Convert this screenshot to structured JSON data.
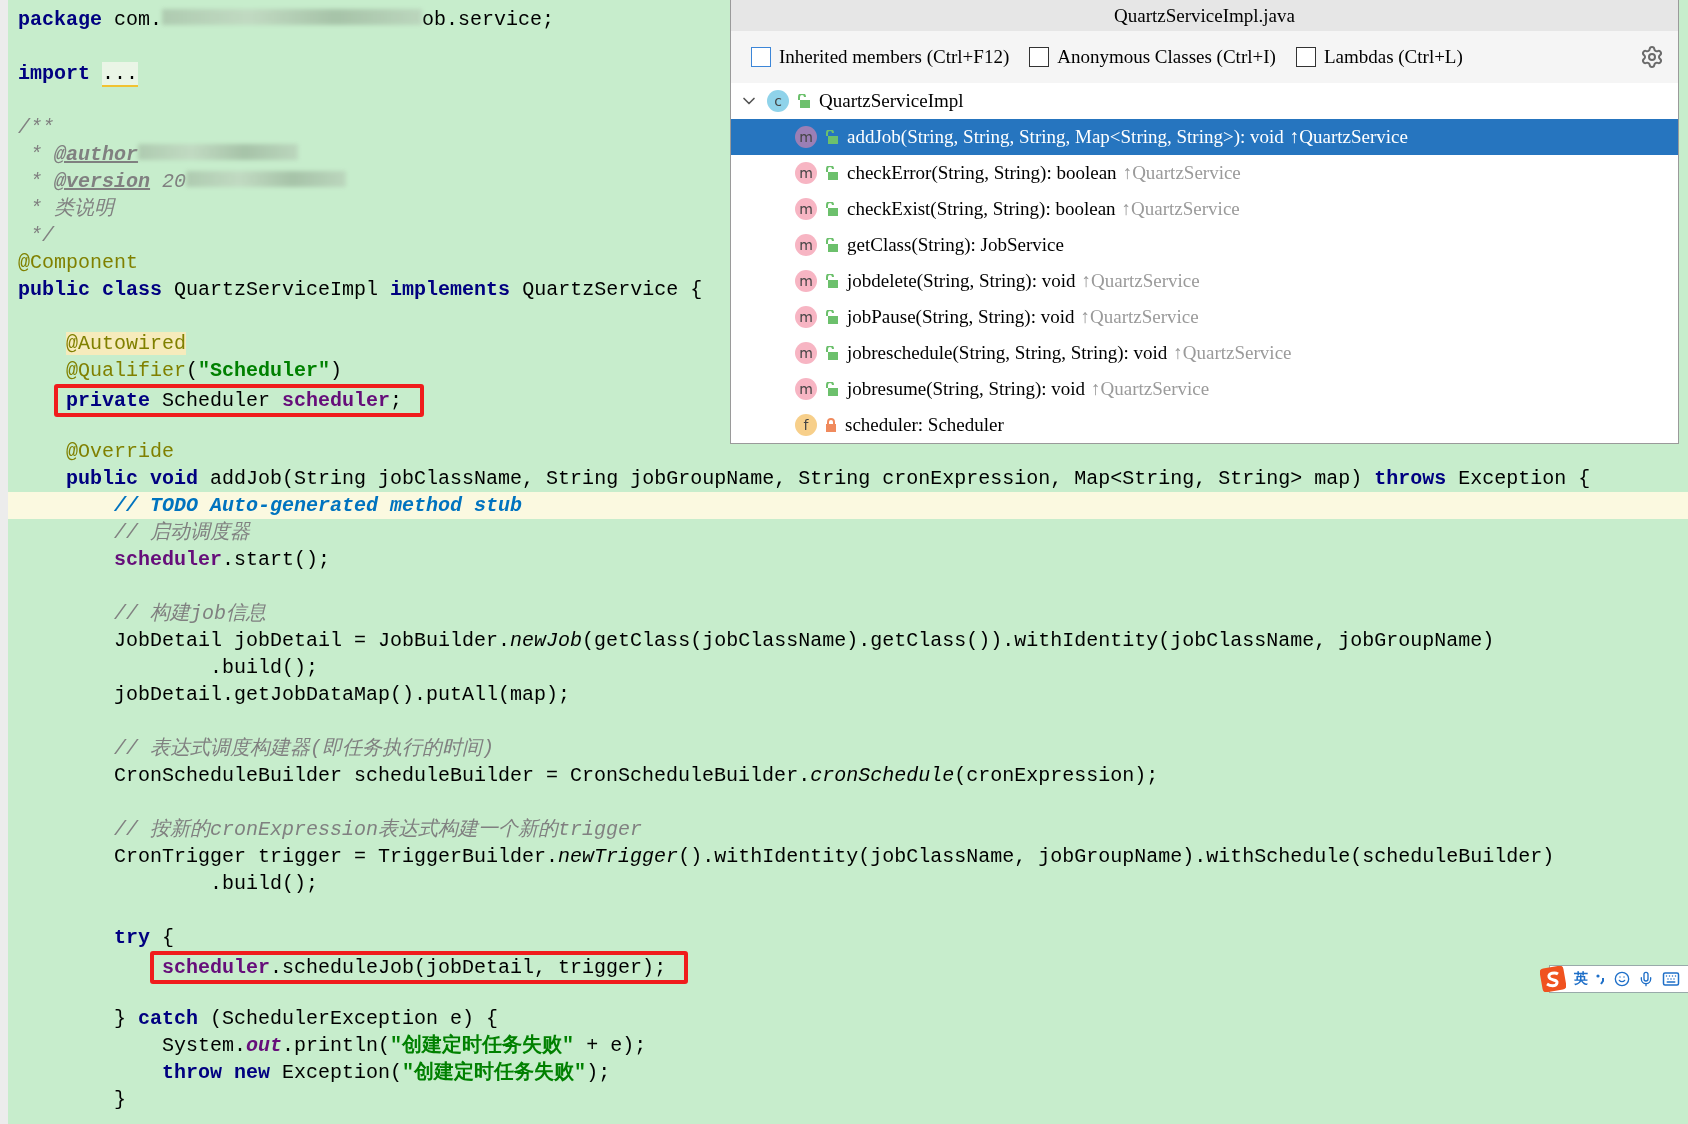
{
  "editor": {
    "lines": [
      {
        "kind": "code",
        "tokens": [
          {
            "kind": "kw",
            "t": "package"
          },
          {
            "kind": "plain",
            "t": " com."
          },
          {
            "kind": "redacted"
          },
          {
            "kind": "plain",
            "t": "ob.service;"
          }
        ]
      },
      {
        "kind": "blank"
      },
      {
        "kind": "code",
        "tokens": [
          {
            "kind": "kw",
            "t": "import "
          },
          {
            "kind": "folded",
            "t": "..."
          }
        ]
      },
      {
        "kind": "blank"
      },
      {
        "kind": "code",
        "tokens": [
          {
            "kind": "cmt",
            "t": "/**"
          }
        ]
      },
      {
        "kind": "code",
        "tokens": [
          {
            "kind": "cmt",
            "t": " * "
          },
          {
            "kind": "doctag",
            "t": "@author"
          },
          {
            "kind": "redacted"
          }
        ]
      },
      {
        "kind": "code",
        "tokens": [
          {
            "kind": "cmt",
            "t": " * "
          },
          {
            "kind": "doctag",
            "t": "@version"
          },
          {
            "kind": "cmt",
            "t": " 20"
          },
          {
            "kind": "redacted"
          }
        ]
      },
      {
        "kind": "code",
        "tokens": [
          {
            "kind": "cmt",
            "t": " * 类说明"
          }
        ]
      },
      {
        "kind": "code",
        "tokens": [
          {
            "kind": "cmt",
            "t": " */"
          }
        ]
      },
      {
        "kind": "code",
        "tokens": [
          {
            "kind": "ann",
            "t": "@Component"
          }
        ]
      },
      {
        "kind": "code",
        "tokens": [
          {
            "kind": "kw",
            "t": "public class"
          },
          {
            "kind": "plain",
            "t": " QuartzServiceImpl "
          },
          {
            "kind": "kw",
            "t": "implements"
          },
          {
            "kind": "plain",
            "t": " QuartzService {"
          }
        ]
      },
      {
        "kind": "blank"
      },
      {
        "kind": "code",
        "tokens": [
          {
            "kind": "annhl",
            "t": "    @Autowired"
          }
        ]
      },
      {
        "kind": "code",
        "tokens": [
          {
            "kind": "ann",
            "t": "    @Qualifier"
          },
          {
            "kind": "plain",
            "t": "("
          },
          {
            "kind": "str",
            "t": "\"Scheduler\""
          },
          {
            "kind": "plain",
            "t": ")"
          }
        ]
      },
      {
        "kind": "code",
        "boxed": true,
        "tokens": [
          {
            "kind": "kw",
            "t": "    private"
          },
          {
            "kind": "plain",
            "t": " Scheduler "
          },
          {
            "kind": "field",
            "t": "scheduler"
          },
          {
            "kind": "plain",
            "t": ";"
          }
        ]
      },
      {
        "kind": "blank"
      },
      {
        "kind": "code",
        "tokens": [
          {
            "kind": "ann",
            "t": "    @Override"
          }
        ]
      },
      {
        "kind": "code",
        "tokens": [
          {
            "kind": "kw",
            "t": "    public void"
          },
          {
            "kind": "plain",
            "t": " addJob(String jobClassName, String jobGroupName, String cronExpression, Map<String, String> map) "
          },
          {
            "kind": "kw",
            "t": "throws"
          },
          {
            "kind": "plain",
            "t": " Exception {"
          }
        ]
      },
      {
        "kind": "code",
        "current": true,
        "tokens": [
          {
            "kind": "todo",
            "t": "        // TODO Auto-generated method stub"
          }
        ]
      },
      {
        "kind": "code",
        "tokens": [
          {
            "kind": "cmt",
            "t": "        // 启动调度器"
          }
        ]
      },
      {
        "kind": "code",
        "tokens": [
          {
            "kind": "field",
            "t": "        scheduler"
          },
          {
            "kind": "plain",
            "t": ".start();"
          }
        ]
      },
      {
        "kind": "blank"
      },
      {
        "kind": "code",
        "tokens": [
          {
            "kind": "cmt",
            "t": "        // 构建job信息"
          }
        ]
      },
      {
        "kind": "code",
        "tokens": [
          {
            "kind": "plain",
            "t": "        JobDetail jobDetail = JobBuilder."
          },
          {
            "kind": "italic",
            "t": "newJob"
          },
          {
            "kind": "plain",
            "t": "(getClass(jobClassName).getClass()).withIdentity(jobClassName, jobGroupName)"
          }
        ]
      },
      {
        "kind": "code",
        "tokens": [
          {
            "kind": "plain",
            "t": "                .build();"
          }
        ]
      },
      {
        "kind": "code",
        "tokens": [
          {
            "kind": "plain",
            "t": "        jobDetail.getJobDataMap().putAll(map);"
          }
        ]
      },
      {
        "kind": "blank"
      },
      {
        "kind": "code",
        "tokens": [
          {
            "kind": "cmt",
            "t": "        // 表达式调度构建器(即任务执行的时间)"
          }
        ]
      },
      {
        "kind": "code",
        "tokens": [
          {
            "kind": "plain",
            "t": "        CronScheduleBuilder scheduleBuilder = CronScheduleBuilder."
          },
          {
            "kind": "italic",
            "t": "cronSchedule"
          },
          {
            "kind": "plain",
            "t": "(cronExpression);"
          }
        ]
      },
      {
        "kind": "blank"
      },
      {
        "kind": "code",
        "tokens": [
          {
            "kind": "cmt",
            "t": "        // 按新的cronExpression表达式构建一个新的trigger"
          }
        ]
      },
      {
        "kind": "code",
        "tokens": [
          {
            "kind": "plain",
            "t": "        CronTrigger trigger = TriggerBuilder."
          },
          {
            "kind": "italic",
            "t": "newTrigger"
          },
          {
            "kind": "plain",
            "t": "().withIdentity(jobClassName, jobGroupName).withSchedule(scheduleBuilder)"
          }
        ]
      },
      {
        "kind": "code",
        "tokens": [
          {
            "kind": "plain",
            "t": "                .build();"
          }
        ]
      },
      {
        "kind": "blank"
      },
      {
        "kind": "code",
        "tokens": [
          {
            "kind": "kw",
            "t": "        try"
          },
          {
            "kind": "plain",
            "t": " {"
          }
        ]
      },
      {
        "kind": "code",
        "boxed": true,
        "tokens": [
          {
            "kind": "field",
            "t": "            scheduler"
          },
          {
            "kind": "plain",
            "t": ".scheduleJob(jobDetail, trigger);"
          }
        ]
      },
      {
        "kind": "blank"
      },
      {
        "kind": "code",
        "tokens": [
          {
            "kind": "plain",
            "t": "        } "
          },
          {
            "kind": "kw",
            "t": "catch"
          },
          {
            "kind": "plain",
            "t": " (SchedulerException e) {"
          }
        ]
      },
      {
        "kind": "code",
        "tokens": [
          {
            "kind": "plain",
            "t": "            System."
          },
          {
            "kind": "static",
            "t": "out"
          },
          {
            "kind": "plain",
            "t": ".println("
          },
          {
            "kind": "str",
            "t": "\"创建定时任务失败\""
          },
          {
            "kind": "plain",
            "t": " + e);"
          }
        ]
      },
      {
        "kind": "code",
        "tokens": [
          {
            "kind": "kw",
            "t": "            throw new"
          },
          {
            "kind": "plain",
            "t": " Exception("
          },
          {
            "kind": "str",
            "t": "\"创建定时任务失败\""
          },
          {
            "kind": "plain",
            "t": ");"
          }
        ]
      },
      {
        "kind": "code",
        "tokens": [
          {
            "kind": "plain",
            "t": "        }"
          }
        ]
      }
    ]
  },
  "structure_popup": {
    "title": "QuartzServiceImpl.java",
    "options": [
      {
        "label": "Inherited members (Ctrl+F12)",
        "checked": false,
        "focused": true
      },
      {
        "label": "Anonymous Classes (Ctrl+I)",
        "checked": false,
        "focused": false
      },
      {
        "label": "Lambdas (Ctrl+L)",
        "checked": false,
        "focused": false
      }
    ],
    "tree": [
      {
        "kind": "class",
        "badge": "c",
        "locked": false,
        "label": "QuartzServiceImpl",
        "expanded": true,
        "selected": false,
        "children": [
          {
            "kind": "method",
            "badge": "m",
            "locked": false,
            "label": "addJob(String, String, String, Map<String, String>): void",
            "origin": "↑QuartzService",
            "selected": true
          },
          {
            "kind": "method",
            "badge": "m",
            "locked": false,
            "label": "checkError(String, String): boolean",
            "origin": "↑QuartzService",
            "selected": false
          },
          {
            "kind": "method",
            "badge": "m",
            "locked": false,
            "label": "checkExist(String, String): boolean",
            "origin": "↑QuartzService",
            "selected": false
          },
          {
            "kind": "method",
            "badge": "m",
            "locked": false,
            "label": "getClass(String): JobService",
            "selected": false
          },
          {
            "kind": "method",
            "badge": "m",
            "locked": false,
            "label": "jobdelete(String, String): void",
            "origin": "↑QuartzService",
            "selected": false
          },
          {
            "kind": "method",
            "badge": "m",
            "locked": false,
            "label": "jobPause(String, String): void",
            "origin": "↑QuartzService",
            "selected": false
          },
          {
            "kind": "method",
            "badge": "m",
            "locked": false,
            "label": "jobreschedule(String, String, String): void",
            "origin": "↑QuartzService",
            "selected": false
          },
          {
            "kind": "method",
            "badge": "m",
            "locked": false,
            "label": "jobresume(String, String): void",
            "origin": "↑QuartzService",
            "selected": false
          },
          {
            "kind": "field",
            "badge": "f",
            "locked": true,
            "label": "scheduler: Scheduler",
            "selected": false
          }
        ]
      }
    ]
  },
  "ime_toolbar": {
    "mode": "英"
  }
}
